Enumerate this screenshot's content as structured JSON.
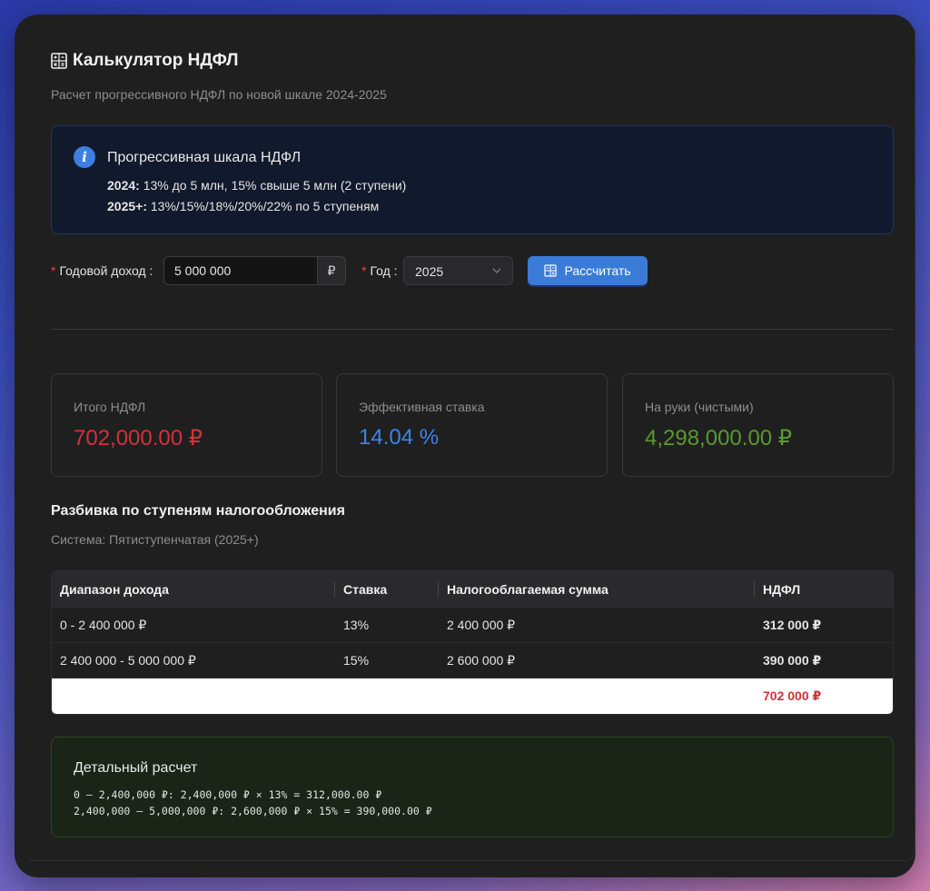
{
  "app": {
    "title": "Калькулятор НДФЛ",
    "subtitle": "Расчет прогрессивного НДФЛ по новой шкале 2024-2025"
  },
  "info": {
    "title": "Прогрессивная шкала НДФЛ",
    "line1_label": "2024:",
    "line1_text": " 13% до 5 млн, 15% свыше 5 млн (2 ступени)",
    "line2_label": "2025+:",
    "line2_text": " 13%/15%/18%/20%/22% по 5 ступеням"
  },
  "form": {
    "income_label": "Годовой доход",
    "income_value": "5 000 000",
    "currency_addon": "₽",
    "year_label": "Год",
    "year_value": "2025",
    "calculate_label": "Рассчитать"
  },
  "stats": {
    "total": {
      "label": "Итого НДФЛ",
      "value": "702,000.00 ₽",
      "color": "#d0333a"
    },
    "rate": {
      "label": "Эффективная ставка",
      "value": "14.04 %",
      "color": "#3d84e6"
    },
    "net": {
      "label": "На руки (чистыми)",
      "value": "4,298,000.00 ₽",
      "color": "#5a9a2c"
    }
  },
  "breakdown": {
    "title": "Разбивка по ступеням налогообложения",
    "system": "Система: Пятиступенчатая (2025+)",
    "columns": [
      "Диапазон дохода",
      "Ставка",
      "Налогооблагаемая сумма",
      "НДФЛ"
    ],
    "rows": [
      {
        "range": "0 - 2 400 000 ₽",
        "rate": "13%",
        "taxable": "2 400 000 ₽",
        "tax": "312 000 ₽"
      },
      {
        "range": "2 400 000 - 5 000 000 ₽",
        "rate": "15%",
        "taxable": "2 600 000 ₽",
        "tax": "390 000 ₽"
      }
    ],
    "total_tax": "702 000 ₽"
  },
  "detail": {
    "title": "Детальный расчет",
    "lines": [
      "0 – 2,400,000 ₽: 2,400,000 ₽ × 13% = 312,000.00 ₽",
      "2,400,000 – 5,000,000 ₽: 2,600,000 ₽ × 15% = 390,000.00 ₽"
    ]
  },
  "colors": {
    "accent": "#3a7bd8",
    "danger": "#d0333a",
    "success": "#5a9a2c",
    "info_bg": "#111a2c",
    "detail_bg": "#1a2517"
  }
}
